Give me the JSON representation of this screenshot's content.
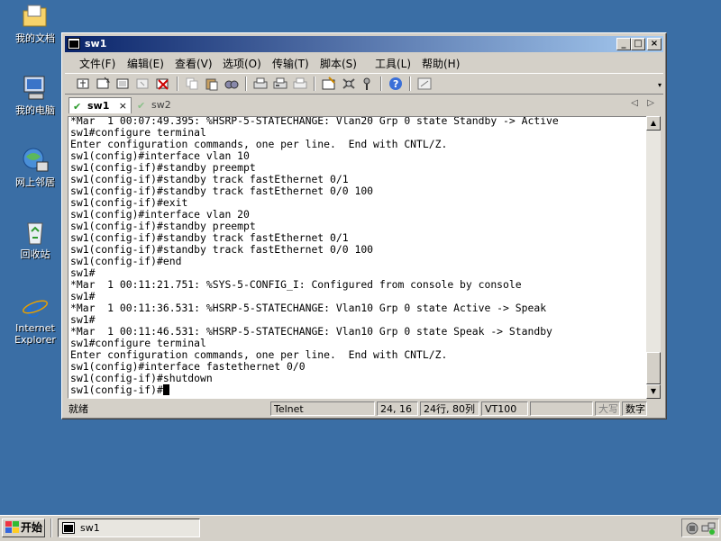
{
  "desktop": {
    "icons": [
      {
        "label": "我的文档",
        "icon": "folder-icon"
      },
      {
        "label": "我的电脑",
        "icon": "computer-icon"
      },
      {
        "label": "网上邻居",
        "icon": "network-icon"
      },
      {
        "label": "回收站",
        "icon": "recycle-bin-icon"
      },
      {
        "label": "Internet Explorer",
        "icon": "internet-explorer-icon"
      }
    ]
  },
  "window": {
    "title": "sw1",
    "menu": [
      "文件(F)",
      "编辑(E)",
      "查看(V)",
      "选项(O)",
      "传输(T)",
      "脚本(S)",
      "工具(L)",
      "帮助(H)"
    ],
    "tabs": [
      {
        "label": "sw1",
        "active": true,
        "close": "×"
      },
      {
        "label": "sw2",
        "active": false
      }
    ],
    "terminal_lines": [
      "*Mar  1 00:07:49.395: %HSRP-5-STATECHANGE: Vlan20 Grp 0 state Standby -> Active",
      "sw1#configure terminal",
      "Enter configuration commands, one per line.  End with CNTL/Z.",
      "sw1(config)#interface vlan 10",
      "sw1(config-if)#standby preempt",
      "sw1(config-if)#standby track fastEthernet 0/1",
      "sw1(config-if)#standby track fastEthernet 0/0 100",
      "sw1(config-if)#exit",
      "sw1(config)#interface vlan 20",
      "sw1(config-if)#standby preempt",
      "sw1(config-if)#standby track fastEthernet 0/1",
      "sw1(config-if)#standby track fastEthernet 0/0 100",
      "sw1(config-if)#end",
      "sw1#",
      "*Mar  1 00:11:21.751: %SYS-5-CONFIG_I: Configured from console by console",
      "sw1#",
      "*Mar  1 00:11:36.531: %HSRP-5-STATECHANGE: Vlan10 Grp 0 state Active -> Speak",
      "sw1#",
      "*Mar  1 00:11:46.531: %HSRP-5-STATECHANGE: Vlan10 Grp 0 state Speak -> Standby",
      "sw1#configure terminal",
      "Enter configuration commands, one per line.  End with CNTL/Z.",
      "sw1(config)#interface fastethernet 0/0",
      "sw1(config-if)#shutdown"
    ],
    "prompt_line": "sw1(config-if)#",
    "status": {
      "ready": "就绪",
      "protocol": "Telnet",
      "cursor_pos": "24, 16",
      "size": "24行, 80列",
      "emulation": "VT100",
      "caps": "大写",
      "num": "数字"
    }
  },
  "taskbar": {
    "start_label": "开始",
    "task_label": "sw1"
  }
}
